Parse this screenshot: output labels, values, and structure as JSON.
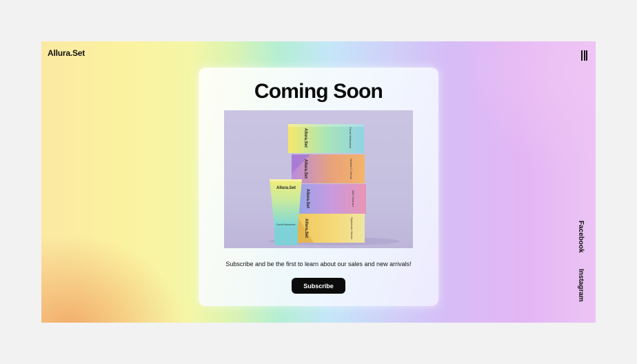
{
  "brand": {
    "name": "Allura.Set"
  },
  "nav": {
    "menu_icon": "hamburger-icon",
    "social": [
      "Facebook",
      "Instagram"
    ]
  },
  "card": {
    "title": "Coming Soon",
    "subtitle": "Subscribe and be the first to learn about our sales and new arrivals!",
    "subscribe_label": "Subscribe"
  },
  "product_image": {
    "tube_brand": "Allura.Set",
    "tube_label": "Facial Moisturizer",
    "boxes": [
      {
        "brand": "Allura.Set",
        "label": "Facial Moisturizer"
      },
      {
        "brand": "Allura.Set",
        "label": "Vitamin C Serum"
      },
      {
        "brand": "Allura.Set",
        "label": "Milk Cleanser"
      },
      {
        "brand": "Allura.Set",
        "label": "Hyaluronic Serum"
      }
    ]
  },
  "colors": {
    "text": "#111111",
    "button_bg": "#0b0b0b",
    "button_text": "#ffffff",
    "page_bg": "#f2f2f3"
  }
}
